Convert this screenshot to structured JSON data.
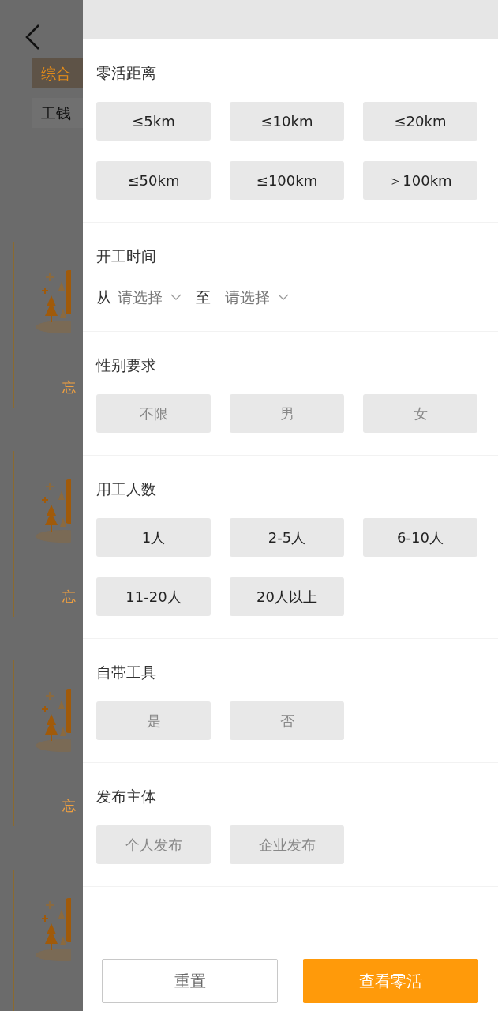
{
  "background": {
    "tabs": [
      {
        "label": "综合",
        "selected": true
      },
      {
        "label": "工钱",
        "selected": false
      }
    ],
    "cards": [
      {
        "kind": "empty-state",
        "caption": "忘"
      },
      {
        "kind": "empty-state",
        "caption": "忘"
      },
      {
        "kind": "empty-state",
        "caption": "忘"
      },
      {
        "kind": "empty-state"
      }
    ]
  },
  "filter": {
    "sections": [
      {
        "kind": "options",
        "title": "零活距离",
        "options": [
          {
            "label": "≤5km",
            "selected": false,
            "disabled": false
          },
          {
            "label": "≤10km",
            "selected": false,
            "disabled": false
          },
          {
            "label": "≤20km",
            "selected": false,
            "disabled": false
          },
          {
            "label": "≤50km",
            "selected": false,
            "disabled": false
          },
          {
            "label": "≤100km",
            "selected": false,
            "disabled": false
          },
          {
            "label": "＞100km",
            "selected": false,
            "disabled": false
          }
        ]
      },
      {
        "kind": "range",
        "title": "开工时间",
        "from_label": "从",
        "from_placeholder": "请选择",
        "to_label": "至",
        "to_placeholder": "请选择"
      },
      {
        "kind": "options",
        "title": "性别要求",
        "options": [
          {
            "label": "不限",
            "selected": false,
            "disabled": true
          },
          {
            "label": "男",
            "selected": false,
            "disabled": true
          },
          {
            "label": "女",
            "selected": false,
            "disabled": true
          }
        ]
      },
      {
        "kind": "options",
        "title": "用工人数",
        "options": [
          {
            "label": "1人",
            "selected": false,
            "disabled": false
          },
          {
            "label": "2-5人",
            "selected": false,
            "disabled": false
          },
          {
            "label": "6-10人",
            "selected": false,
            "disabled": false
          },
          {
            "label": "11-20人",
            "selected": false,
            "disabled": false
          },
          {
            "label": "20人以上",
            "selected": false,
            "disabled": false
          }
        ]
      },
      {
        "kind": "options",
        "title": "自带工具",
        "options": [
          {
            "label": "是",
            "selected": false,
            "disabled": true
          },
          {
            "label": "否",
            "selected": false,
            "disabled": true
          }
        ]
      },
      {
        "kind": "options",
        "title": "发布主体",
        "options": [
          {
            "label": "个人发布",
            "selected": false,
            "disabled": true
          },
          {
            "label": "企业发布",
            "selected": false,
            "disabled": true
          }
        ]
      }
    ],
    "buttons": {
      "reset": "重置",
      "submit": "查看零活"
    }
  }
}
